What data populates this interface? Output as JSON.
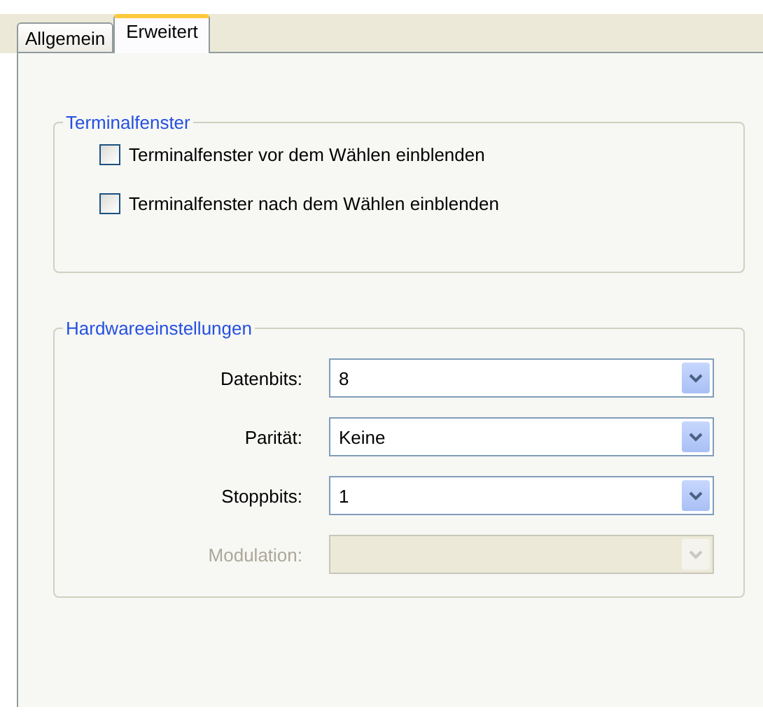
{
  "tabs": [
    {
      "label": "Allgemein",
      "selected": false
    },
    {
      "label": "Erweitert",
      "selected": true
    }
  ],
  "terminal_group": {
    "title": "Terminalfenster",
    "options": [
      {
        "label": "Terminalfenster vor dem Wählen einblenden",
        "checked": false
      },
      {
        "label": "Terminalfenster nach dem Wählen einblenden",
        "checked": false
      }
    ]
  },
  "hardware_group": {
    "title": "Hardwareeinstellungen",
    "fields": [
      {
        "label": "Datenbits:",
        "value": "8",
        "disabled": false
      },
      {
        "label": "Parität:",
        "value": "Keine",
        "disabled": false
      },
      {
        "label": "Stoppbits:",
        "value": "1",
        "disabled": false
      },
      {
        "label": "Modulation:",
        "disabled": true
      }
    ]
  }
}
